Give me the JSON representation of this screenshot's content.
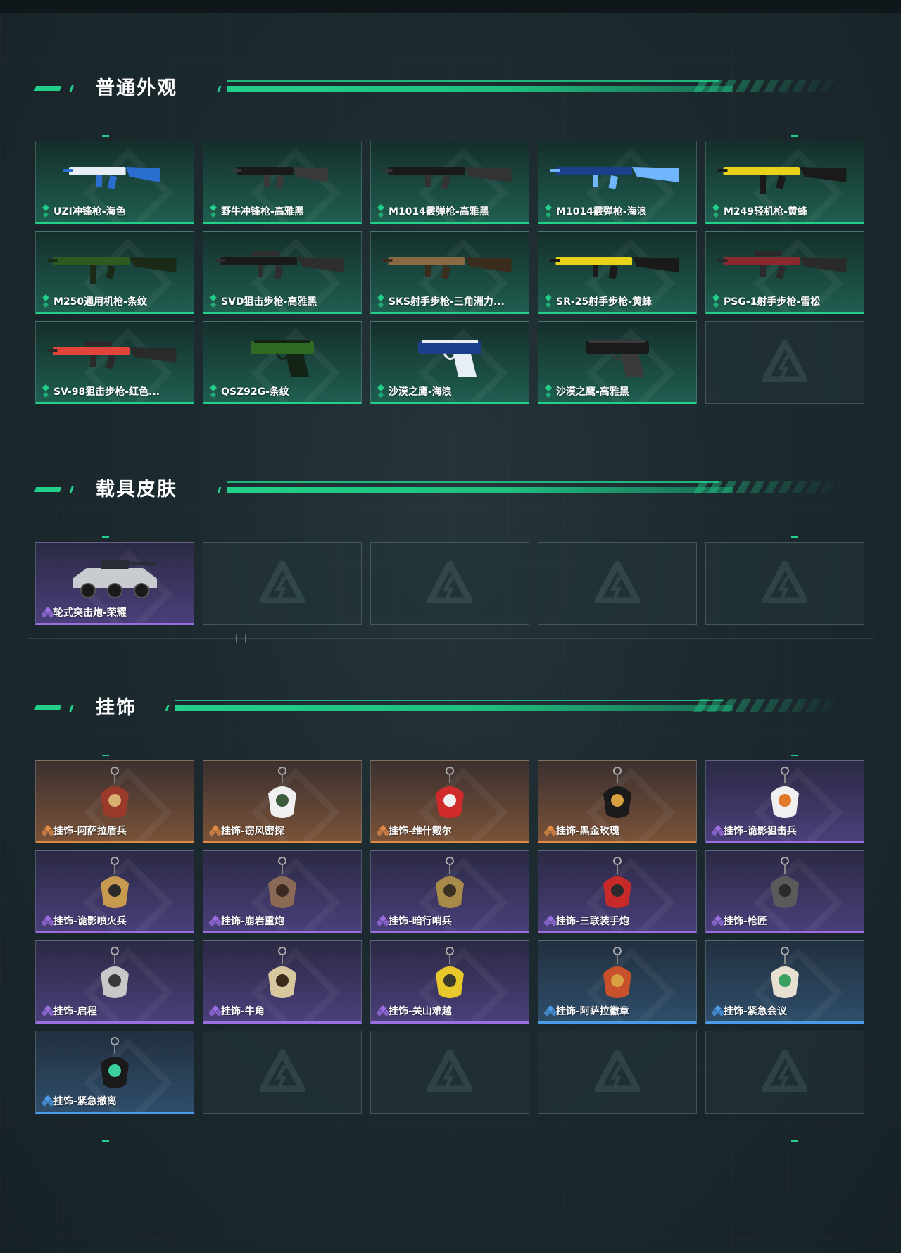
{
  "sections": [
    {
      "title": "普通外观",
      "items": [
        {
          "label": "UZI冲锋枪-海色",
          "rarity": "green",
          "icon": "smg-icon",
          "colors": [
            "#e8eef5",
            "#2a6fd0"
          ]
        },
        {
          "label": "野牛冲锋枪-高雅黑",
          "rarity": "green",
          "icon": "smg-icon",
          "colors": [
            "#1a1a1a",
            "#3a3a3a"
          ]
        },
        {
          "label": "M1014霰弹枪-高雅黑",
          "rarity": "green",
          "icon": "shotgun-icon",
          "colors": [
            "#1a1a1a",
            "#333333"
          ]
        },
        {
          "label": "M1014霰弹枪-海浪",
          "rarity": "green",
          "icon": "shotgun-icon",
          "colors": [
            "#1b3f8a",
            "#6fb6ff"
          ]
        },
        {
          "label": "M249轻机枪-黄蜂",
          "rarity": "green",
          "icon": "lmg-icon",
          "colors": [
            "#e8d21a",
            "#1a1a1a"
          ]
        },
        {
          "label": "M250通用机枪-条纹",
          "rarity": "green",
          "icon": "lmg-icon",
          "colors": [
            "#2f5a22",
            "#1a2a16"
          ]
        },
        {
          "label": "SVD狙击步枪-高雅黑",
          "rarity": "green",
          "icon": "sniper-icon",
          "colors": [
            "#1a1a1a",
            "#2e2e2e"
          ]
        },
        {
          "label": "SKS射手步枪-三角洲力...",
          "rarity": "green",
          "icon": "rifle-icon",
          "colors": [
            "#8a6a45",
            "#3a2d1e"
          ]
        },
        {
          "label": "SR-25射手步枪-黄蜂",
          "rarity": "green",
          "icon": "rifle-icon",
          "colors": [
            "#e8d21a",
            "#1a1a1a"
          ]
        },
        {
          "label": "PSG-1射手步枪-雪松",
          "rarity": "green",
          "icon": "sniper-icon",
          "colors": [
            "#8a2a2e",
            "#2a2a2a"
          ]
        },
        {
          "label": "SV-98狙击步枪-红色...",
          "rarity": "green",
          "icon": "sniper-icon",
          "colors": [
            "#e0443a",
            "#2a2a2a"
          ]
        },
        {
          "label": "QSZ92G-条纹",
          "rarity": "green",
          "icon": "pistol-icon",
          "colors": [
            "#2f6a22",
            "#142414"
          ]
        },
        {
          "label": "沙漠之鹰-海浪",
          "rarity": "green",
          "icon": "pistol-icon",
          "colors": [
            "#1b3f8a",
            "#e8eef5"
          ]
        },
        {
          "label": "沙漠之鹰-高雅黑",
          "rarity": "green",
          "icon": "pistol-icon",
          "colors": [
            "#1a1a1a",
            "#3a3a3a"
          ]
        },
        {
          "label": "",
          "rarity": "empty",
          "icon": "empty-slot-logo-icon"
        }
      ]
    },
    {
      "title": "载具皮肤",
      "items": [
        {
          "label": "轮式突击炮-荣耀",
          "rarity": "purple",
          "icon": "armored-vehicle-icon",
          "colors": [
            "#c8ccd0",
            "#2a2e34"
          ]
        },
        {
          "label": "",
          "rarity": "empty",
          "icon": "empty-slot-logo-icon"
        },
        {
          "label": "",
          "rarity": "empty",
          "icon": "empty-slot-logo-icon"
        },
        {
          "label": "",
          "rarity": "empty",
          "icon": "empty-slot-logo-icon"
        },
        {
          "label": "",
          "rarity": "empty",
          "icon": "empty-slot-logo-icon"
        }
      ]
    },
    {
      "title": "挂饰",
      "items": [
        {
          "label": "挂饰-阿萨拉盾兵",
          "rarity": "orange",
          "icon": "charm-icon",
          "colors": [
            "#9a3a2a",
            "#d8b070"
          ]
        },
        {
          "label": "挂饰-窃风密探",
          "rarity": "orange",
          "icon": "charm-icon",
          "colors": [
            "#f0f0f0",
            "#3a5a3a"
          ]
        },
        {
          "label": "挂饰-维什戴尔",
          "rarity": "orange",
          "icon": "charm-icon",
          "colors": [
            "#d02a2a",
            "#f0f0f0"
          ]
        },
        {
          "label": "挂饰-黑金玫瑰",
          "rarity": "orange",
          "icon": "charm-icon",
          "colors": [
            "#1a1a1a",
            "#d8a040"
          ]
        },
        {
          "label": "挂饰-诡影狙击兵",
          "rarity": "purple",
          "icon": "charm-icon",
          "colors": [
            "#f0f0f0",
            "#e07a2a"
          ]
        },
        {
          "label": "挂饰-诡影喷火兵",
          "rarity": "purple",
          "icon": "charm-icon",
          "colors": [
            "#c89a50",
            "#2a2a2a"
          ]
        },
        {
          "label": "挂饰-崩岩重炮",
          "rarity": "purple",
          "icon": "charm-icon",
          "colors": [
            "#8a6a55",
            "#3a2a22"
          ]
        },
        {
          "label": "挂饰-暗行哨兵",
          "rarity": "purple",
          "icon": "charm-icon",
          "colors": [
            "#a88a4a",
            "#3a3022"
          ]
        },
        {
          "label": "挂饰-三联装手炮",
          "rarity": "purple",
          "icon": "charm-icon",
          "colors": [
            "#c82a2a",
            "#2a2a2a"
          ]
        },
        {
          "label": "挂饰-枪匠",
          "rarity": "purple",
          "icon": "charm-icon",
          "colors": [
            "#5a5a5a",
            "#2a2a2a"
          ]
        },
        {
          "label": "挂饰-启程",
          "rarity": "purple",
          "icon": "charm-icon",
          "colors": [
            "#c8c8c8",
            "#3a3a3a"
          ]
        },
        {
          "label": "挂饰-牛角",
          "rarity": "purple",
          "icon": "charm-icon",
          "colors": [
            "#d8c8a0",
            "#3a2a1a"
          ]
        },
        {
          "label": "挂饰-关山难越",
          "rarity": "purple",
          "icon": "charm-icon",
          "colors": [
            "#e8c82a",
            "#3a3a2a"
          ]
        },
        {
          "label": "挂饰-阿萨拉徽章",
          "rarity": "blue",
          "icon": "charm-icon",
          "colors": [
            "#c8502a",
            "#d8a040"
          ]
        },
        {
          "label": "挂饰-紧急会议",
          "rarity": "blue",
          "icon": "charm-icon",
          "colors": [
            "#e8e0d0",
            "#3aa060"
          ]
        },
        {
          "label": "挂饰-紧急撤离",
          "rarity": "blue",
          "icon": "charm-icon",
          "colors": [
            "#1a1a1a",
            "#3ad0a0"
          ]
        },
        {
          "label": "",
          "rarity": "empty",
          "icon": "empty-slot-logo-icon"
        },
        {
          "label": "",
          "rarity": "empty",
          "icon": "empty-slot-logo-icon"
        },
        {
          "label": "",
          "rarity": "empty",
          "icon": "empty-slot-logo-icon"
        },
        {
          "label": "",
          "rarity": "empty",
          "icon": "empty-slot-logo-icon"
        }
      ]
    }
  ],
  "theme": {
    "accent": "#22d08a",
    "rarity_colors": {
      "green": "#22d08a",
      "purple": "#9a6de0",
      "orange": "#e08a45",
      "blue": "#4a9be8"
    }
  }
}
